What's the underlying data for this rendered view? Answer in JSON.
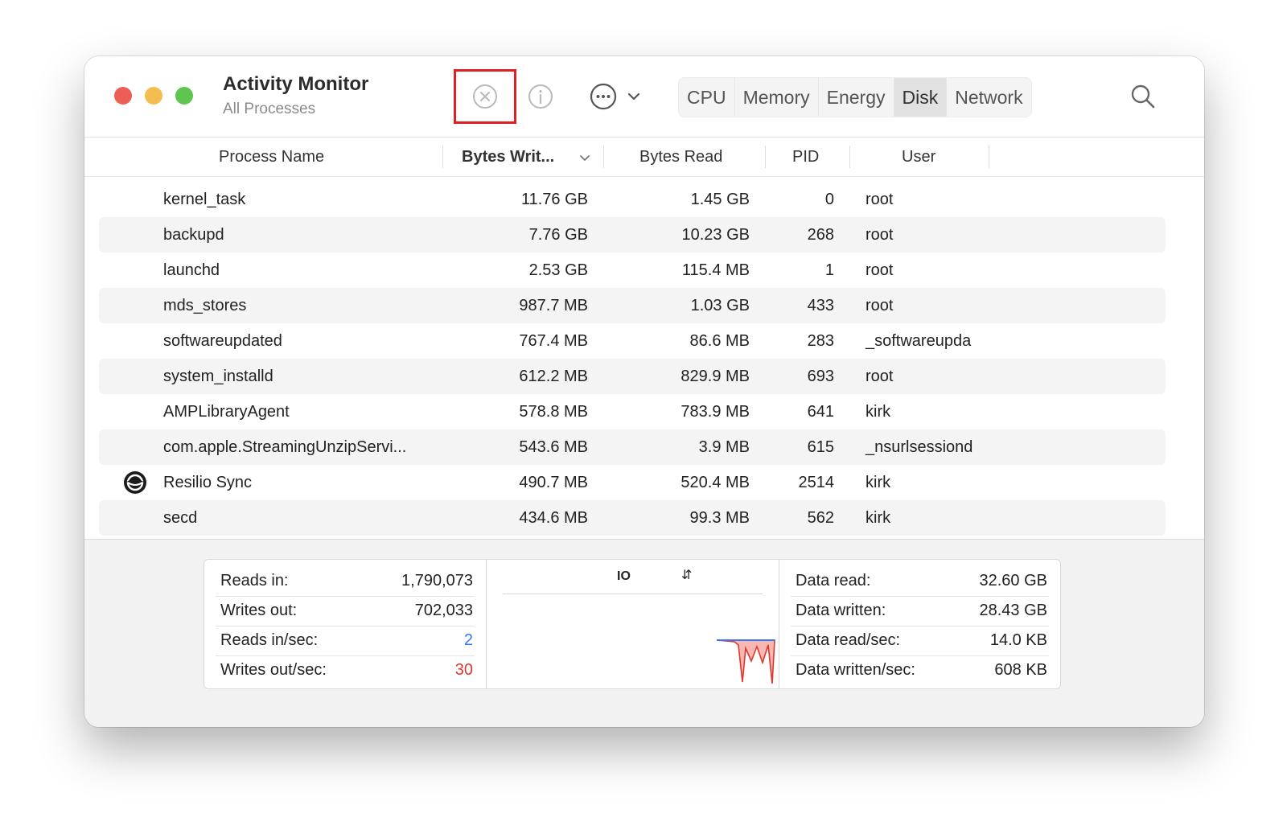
{
  "window": {
    "title": "Activity Monitor",
    "subtitle": "All Processes"
  },
  "toolbar": {
    "stop_icon": "stop-process-icon",
    "info_icon": "info-icon",
    "more_icon": "more-options-icon",
    "search_icon": "search-icon",
    "highlight_color": "#e02020"
  },
  "tabs": [
    {
      "label": "CPU",
      "active": false
    },
    {
      "label": "Memory",
      "active": false
    },
    {
      "label": "Energy",
      "active": false
    },
    {
      "label": "Disk",
      "active": true
    },
    {
      "label": "Network",
      "active": false
    }
  ],
  "table": {
    "columns": {
      "name": "Process Name",
      "bytes_written": "Bytes Writ...",
      "bytes_read": "Bytes Read",
      "pid": "PID",
      "user": "User"
    },
    "sorted_column": "bytes_written",
    "rows": [
      {
        "name": "kernel_task",
        "bytes_written": "11.76 GB",
        "bytes_read": "1.45 GB",
        "pid": "0",
        "user": "root",
        "icon": ""
      },
      {
        "name": "backupd",
        "bytes_written": "7.76 GB",
        "bytes_read": "10.23 GB",
        "pid": "268",
        "user": "root",
        "icon": ""
      },
      {
        "name": "launchd",
        "bytes_written": "2.53 GB",
        "bytes_read": "115.4 MB",
        "pid": "1",
        "user": "root",
        "icon": ""
      },
      {
        "name": "mds_stores",
        "bytes_written": "987.7 MB",
        "bytes_read": "1.03 GB",
        "pid": "433",
        "user": "root",
        "icon": ""
      },
      {
        "name": "softwareupdated",
        "bytes_written": "767.4 MB",
        "bytes_read": "86.6 MB",
        "pid": "283",
        "user": "_softwareupda",
        "icon": ""
      },
      {
        "name": "system_installd",
        "bytes_written": "612.2 MB",
        "bytes_read": "829.9 MB",
        "pid": "693",
        "user": "root",
        "icon": ""
      },
      {
        "name": "AMPLibraryAgent",
        "bytes_written": "578.8 MB",
        "bytes_read": "783.9 MB",
        "pid": "641",
        "user": "kirk",
        "icon": ""
      },
      {
        "name": "com.apple.StreamingUnzipServi...",
        "bytes_written": "543.6 MB",
        "bytes_read": "3.9 MB",
        "pid": "615",
        "user": "_nsurlsessiond",
        "icon": ""
      },
      {
        "name": "Resilio Sync",
        "bytes_written": "490.7 MB",
        "bytes_read": "520.4 MB",
        "pid": "2514",
        "user": "kirk",
        "icon": "resilio-sync-icon"
      },
      {
        "name": "secd",
        "bytes_written": "434.6 MB",
        "bytes_read": "99.3 MB",
        "pid": "562",
        "user": "kirk",
        "icon": ""
      }
    ]
  },
  "stats": {
    "left": [
      {
        "label": "Reads in:",
        "value": "1,790,073"
      },
      {
        "label": "Writes out:",
        "value": "702,033"
      },
      {
        "label": "Reads in/sec:",
        "value": "2",
        "color": "#3478f6"
      },
      {
        "label": "Writes out/sec:",
        "value": "30",
        "color": "#e0362c"
      }
    ],
    "graph_label": "IO",
    "right": [
      {
        "label": "Data read:",
        "value": "32.60 GB"
      },
      {
        "label": "Data written:",
        "value": "28.43 GB"
      },
      {
        "label": "Data read/sec:",
        "value": "14.0 KB"
      },
      {
        "label": "Data written/sec:",
        "value": "608 KB"
      }
    ]
  }
}
